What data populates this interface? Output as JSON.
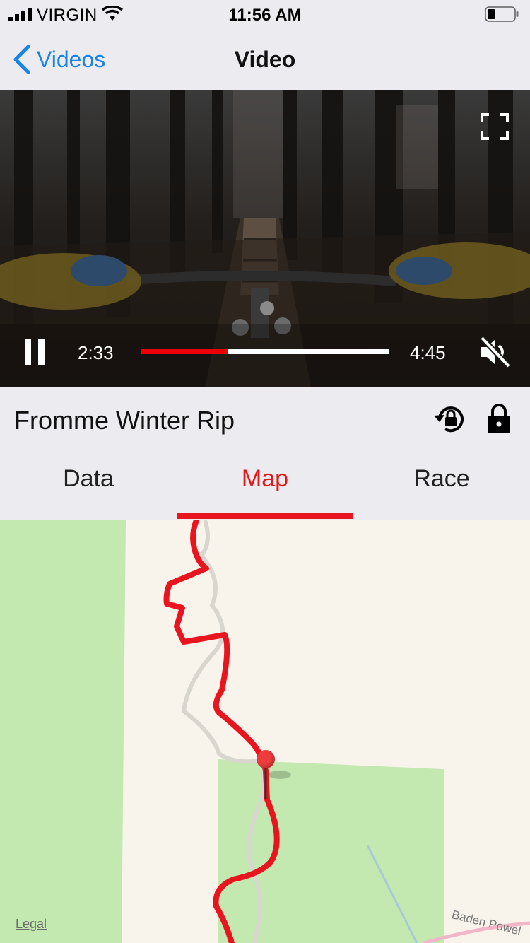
{
  "status_bar": {
    "carrier": "VIRGIN",
    "time": "11:56 AM",
    "battery_level": 0.3
  },
  "nav": {
    "back_label": "Videos",
    "title": "Video"
  },
  "video": {
    "current_time": "2:33",
    "total_time": "4:45",
    "progress": 0.35,
    "muted": true
  },
  "title_bar": {
    "video_title": "Fromme Winter Rip"
  },
  "tabs": [
    {
      "label": "Data",
      "active": false
    },
    {
      "label": "Map",
      "active": true
    },
    {
      "label": "Race",
      "active": false
    }
  ],
  "map": {
    "legal_label": "Legal",
    "street_label": "Baden Powel"
  },
  "colors": {
    "accent": "#e8141e",
    "link": "#1a83e6",
    "park": "#c3e8b0",
    "land": "#f8f4ec"
  }
}
